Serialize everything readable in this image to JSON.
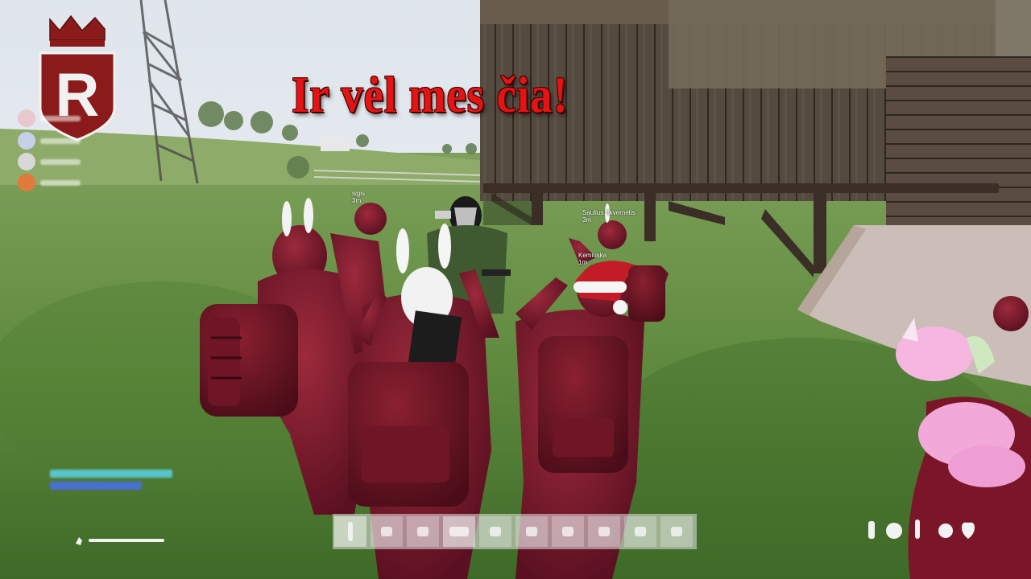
{
  "title": "Ir vėl mes čia!",
  "logo": {
    "letter": "R",
    "color": "#8b1a1a"
  },
  "players": [
    {
      "name": "sigis",
      "distance": "3m"
    },
    {
      "name": "Saulius Skvernelis",
      "distance": "3m"
    },
    {
      "name": "Kemiuska",
      "distance": "1m"
    }
  ],
  "party_members": [
    {
      "color": "#e8c8cc"
    },
    {
      "color": "#c8d0e8"
    },
    {
      "color": "#d8d8d8"
    },
    {
      "color": "#e07a3a"
    }
  ],
  "hotbar_slots": 10
}
